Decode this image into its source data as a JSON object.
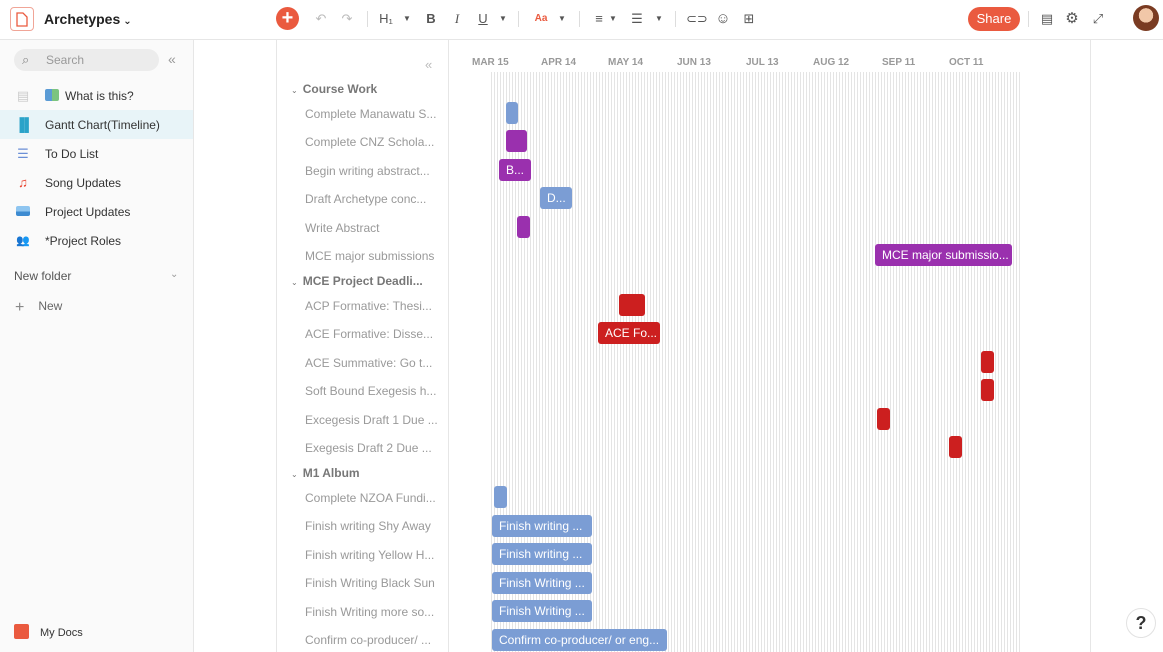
{
  "header": {
    "title": "Archetypes",
    "share_label": "Share",
    "toolbar": {
      "heading": "H₁",
      "bold": "B",
      "italic": "I",
      "underline": "U",
      "font_size": "Aa"
    }
  },
  "sidebar": {
    "search_placeholder": "Search",
    "items": [
      {
        "label": "What is this?",
        "icon": "map-icon"
      },
      {
        "label": "Gantt Chart(Timeline)",
        "icon": "bar-chart-icon"
      },
      {
        "label": "To Do List",
        "icon": "checklist-icon"
      },
      {
        "label": "Song Updates",
        "icon": "music-note-icon"
      },
      {
        "label": "Project Updates",
        "icon": "image-icon"
      },
      {
        "label": "*Project Roles",
        "icon": "people-icon"
      }
    ],
    "folder_label": "New folder",
    "new_label": "New",
    "footer_label": "My Docs"
  },
  "gantt": {
    "months": [
      "MAR 15",
      "APR 14",
      "MAY 14",
      "JUN 13",
      "JUL 13",
      "AUG 12",
      "SEP 11",
      "OCT 11"
    ],
    "groups": [
      "Course Work",
      "MCE Project Deadli...",
      "M1 Album"
    ],
    "tasks": [
      "Complete Manawatu S...",
      "Complete CNZ Schola...",
      "Begin writing abstract...",
      "Draft Archetype conc...",
      "Write Abstract",
      "MCE major submissions",
      "ACP Formative: Thesi...",
      "ACE Formative: Disse...",
      "ACE Summative: Go t...",
      "Soft Bound Exegesis h...",
      "Excegesis Draft 1 Due ...",
      "Exegesis Draft 2 Due ...",
      "Complete NZOA Fundi...",
      "Finish writing Shy Away",
      "Finish writing Yellow H...",
      "Finish Writing Black Sun",
      "Finish Writing more so...",
      "Confirm co-producer/ ..."
    ],
    "bar_labels": {
      "begin_abstract": "B...",
      "draft_archetype": "D...",
      "mce_major": "MCE major submissio...",
      "ace_formative": "ACE Fo...",
      "shy_away": "Finish writing ...",
      "yellow": "Finish writing ...",
      "black_sun": "Finish Writing ...",
      "more_songs": "Finish Writing ...",
      "co_producer": "Confirm co-producer/ or eng..."
    }
  },
  "colors": {
    "accent": "#ea5a3f",
    "bar_blue": "#7b9dd4",
    "bar_purple": "#9a30ae",
    "bar_red": "#cc1f1f"
  },
  "help_label": "?"
}
